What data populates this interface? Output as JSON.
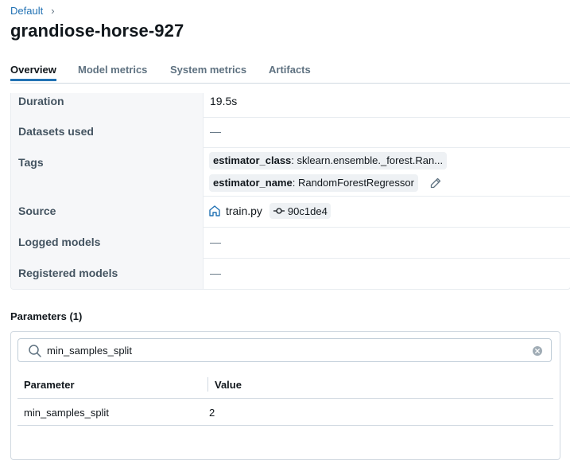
{
  "breadcrumb": {
    "parent": "Default",
    "separator": "›"
  },
  "run": {
    "title": "grandiose-horse-927"
  },
  "tabs": [
    {
      "label": "Overview",
      "active": true
    },
    {
      "label": "Model metrics",
      "active": false
    },
    {
      "label": "System metrics",
      "active": false
    },
    {
      "label": "Artifacts",
      "active": false
    }
  ],
  "details": {
    "duration": {
      "label": "Duration",
      "value": "19.5s"
    },
    "datasets": {
      "label": "Datasets used",
      "value": "—"
    },
    "tags": {
      "label": "Tags",
      "items": [
        {
          "key": "estimator_class",
          "value": "sklearn.ensemble._forest.Ran..."
        },
        {
          "key": "estimator_name",
          "value": "RandomForestRegressor"
        }
      ]
    },
    "source": {
      "label": "Source",
      "file": "train.py",
      "commit": "90c1de4"
    },
    "logged_models": {
      "label": "Logged models",
      "value": "—"
    },
    "registered_models": {
      "label": "Registered models",
      "value": "—"
    }
  },
  "parameters": {
    "title": "Parameters (1)",
    "search_value": "min_samples_split",
    "columns": [
      "Parameter",
      "Value"
    ],
    "rows": [
      {
        "name": "min_samples_split",
        "value": "2"
      }
    ]
  },
  "colors": {
    "accent": "#2272b4",
    "label_bg": "#f6f7f9",
    "tag_bg": "#eef1f4"
  }
}
